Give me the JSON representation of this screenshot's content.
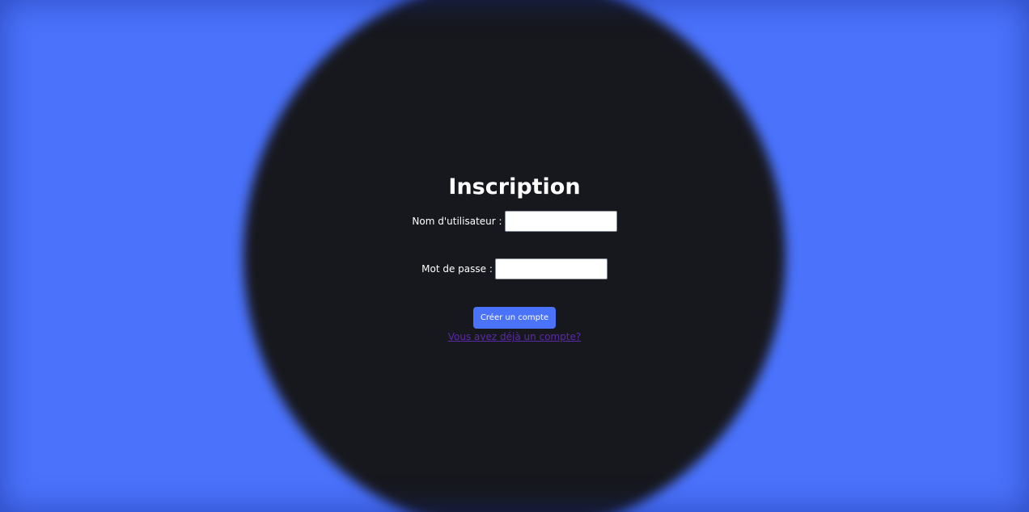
{
  "page": {
    "title": "Inscription",
    "background_color": "#4a72fb",
    "panel_color": "#17181d"
  },
  "form": {
    "username_label": "Nom d'utilisateur :",
    "username_value": "",
    "password_label": "Mot de passe :",
    "password_value": "",
    "submit_label": "Créer un compte",
    "login_link": "Vous avez déjà un compte?",
    "accent_color": "#4a72fb",
    "link_color": "#5b2aa8"
  }
}
